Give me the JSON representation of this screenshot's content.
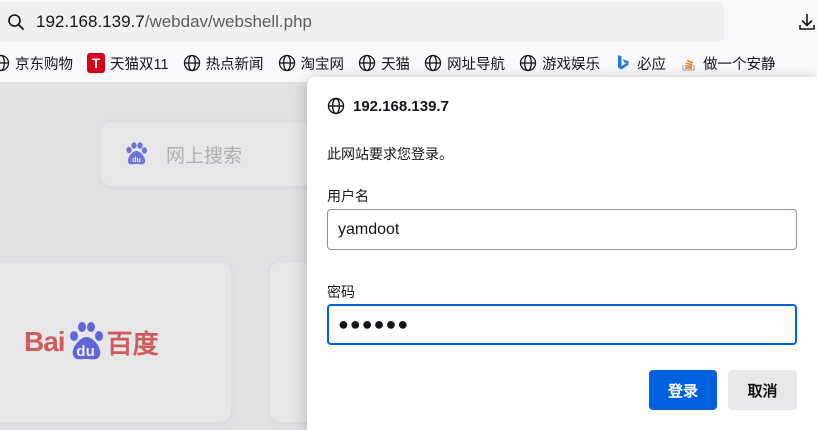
{
  "urlbar": {
    "host": "192.168.139.7",
    "path": "/webdav/webshell.php"
  },
  "bookmarks": [
    {
      "label": "京东购物",
      "icon": "globe-icon"
    },
    {
      "label": "天猫双11",
      "icon": "tmall-icon"
    },
    {
      "label": "热点新闻",
      "icon": "globe-icon"
    },
    {
      "label": "淘宝网",
      "icon": "globe-icon"
    },
    {
      "label": "天猫",
      "icon": "globe-icon"
    },
    {
      "label": "网址导航",
      "icon": "globe-icon"
    },
    {
      "label": "游戏娱乐",
      "icon": "globe-icon"
    },
    {
      "label": "必应",
      "icon": "bing-icon"
    },
    {
      "label": "做一个安静",
      "icon": "stackoverflow-icon"
    }
  ],
  "tmall_glyph": "T",
  "page": {
    "search_placeholder": "网上搜索",
    "baidu_logo_bai": "Bai",
    "baidu_logo_du": "du",
    "baidu_logo_cn": "百度"
  },
  "dialog": {
    "host": "192.168.139.7",
    "message": "此网站要求您登录。",
    "username_label": "用户名",
    "username_value": "yamdoot",
    "password_label": "密码",
    "password_value": "●●●●●●",
    "login_label": "登录",
    "cancel_label": "取消"
  },
  "colors": {
    "accent": "#0061e0",
    "baidu_red": "#d2231d",
    "baidu_blue": "#2932e1",
    "tmall_red": "#d9001b"
  }
}
